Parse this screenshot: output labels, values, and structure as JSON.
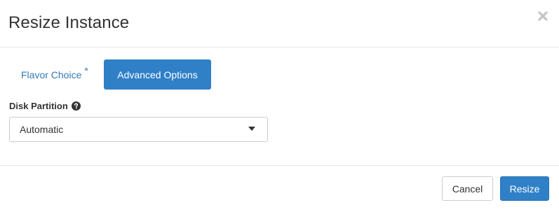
{
  "dialog": {
    "title": "Resize Instance"
  },
  "tabs": [
    {
      "label": "Flavor Choice",
      "required_marker": "*",
      "active": false
    },
    {
      "label": "Advanced Options",
      "active": true
    }
  ],
  "disk_partition": {
    "label": "Disk Partition",
    "help_icon": "question-circle-icon",
    "selected": "Automatic"
  },
  "footer": {
    "cancel_label": "Cancel",
    "resize_label": "Resize"
  },
  "colors": {
    "primary": "#2f80c7",
    "link": "#337ab7",
    "text": "#333333",
    "border": "#cccccc"
  }
}
